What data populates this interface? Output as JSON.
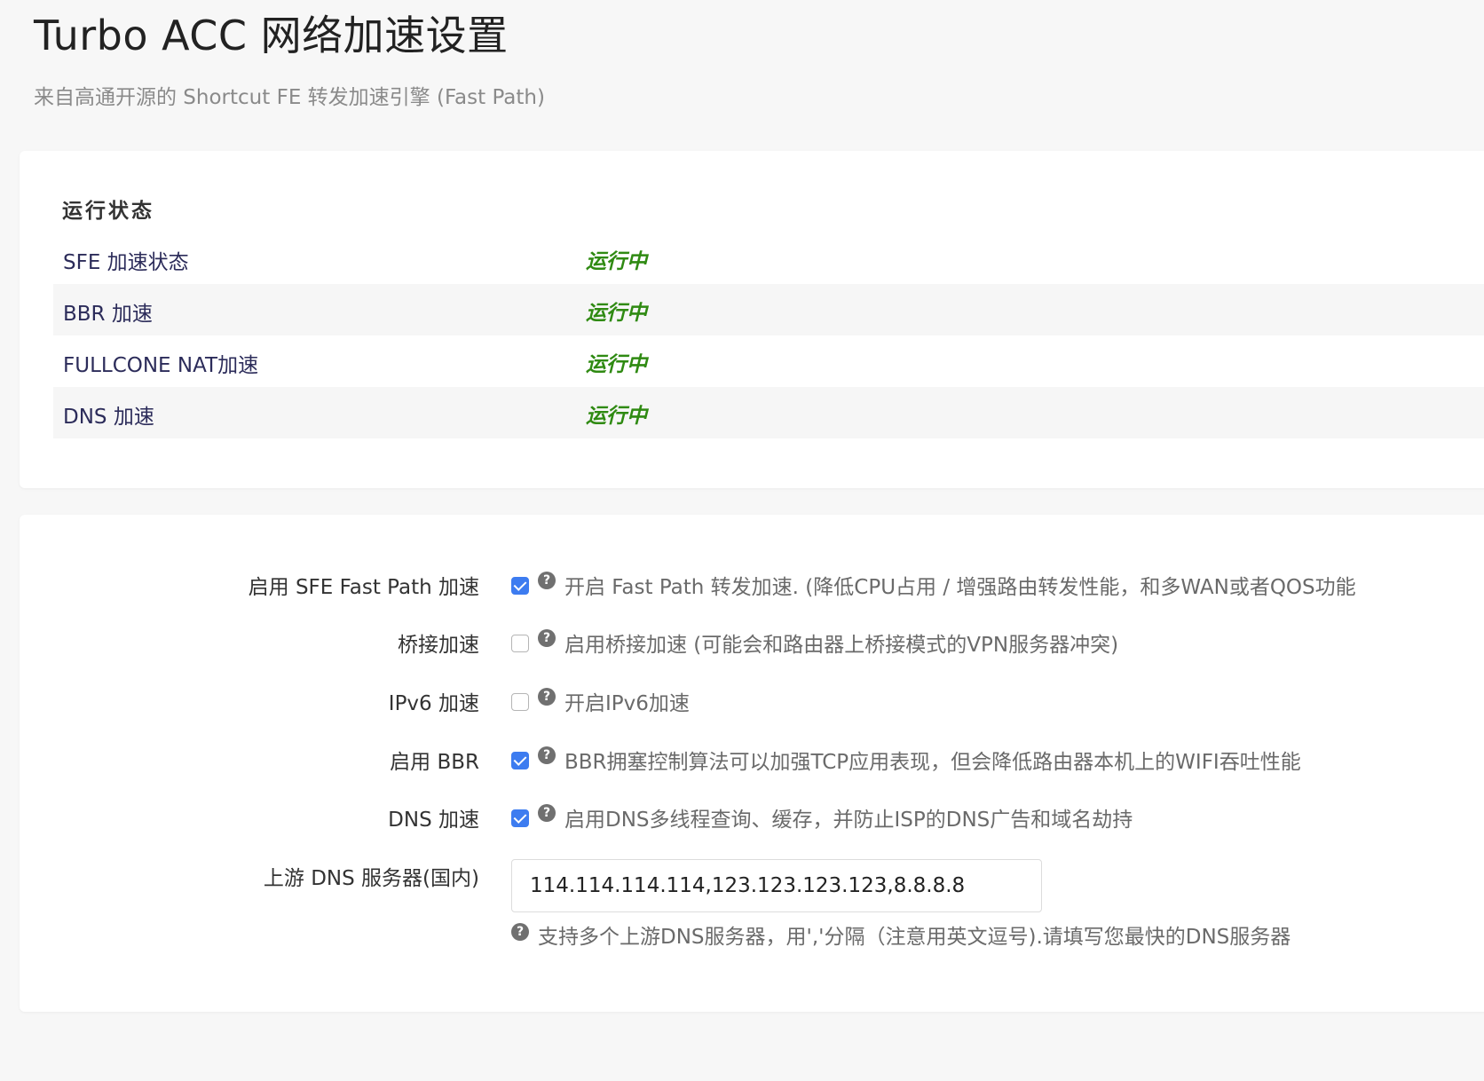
{
  "header": {
    "title": "Turbo ACC 网络加速设置",
    "subtitle": "来自高通开源的 Shortcut FE 转发加速引擎 (Fast Path)"
  },
  "status": {
    "section_title": "运行状态",
    "rows": [
      {
        "label": "SFE 加速状态",
        "value": "运行中"
      },
      {
        "label": "BBR 加速",
        "value": "运行中"
      },
      {
        "label": "FULLCONE NAT加速",
        "value": "运行中"
      },
      {
        "label": "DNS 加速",
        "value": "运行中"
      }
    ]
  },
  "settings": {
    "help_glyph": "?",
    "options": [
      {
        "label": "启用 SFE Fast Path 加速",
        "checked": true,
        "desc": "开启 Fast Path 转发加速. (降低CPU占用 / 增强路由转发性能，和多WAN或者QOS功能"
      },
      {
        "label": "桥接加速",
        "checked": false,
        "desc": "启用桥接加速 (可能会和路由器上桥接模式的VPN服务器冲突)"
      },
      {
        "label": "IPv6 加速",
        "checked": false,
        "desc": "开启IPv6加速"
      },
      {
        "label": "启用 BBR",
        "checked": true,
        "desc": "BBR拥塞控制算法可以加强TCP应用表现，但会降低路由器本机上的WIFI吞吐性能"
      },
      {
        "label": "DNS 加速",
        "checked": true,
        "desc": "启用DNS多线程查询、缓存，并防止ISP的DNS广告和域名劫持"
      }
    ],
    "upstream_dns": {
      "label": "上游 DNS 服务器(国内)",
      "value": "114.114.114.114,123.123.123.123,8.8.8.8",
      "hint": "支持多个上游DNS服务器，用','分隔（注意用英文逗号).请填写您最快的DNS服务器"
    }
  },
  "colors": {
    "status_running": "#2f8a12",
    "checkbox_checked": "#3d7cf0"
  }
}
